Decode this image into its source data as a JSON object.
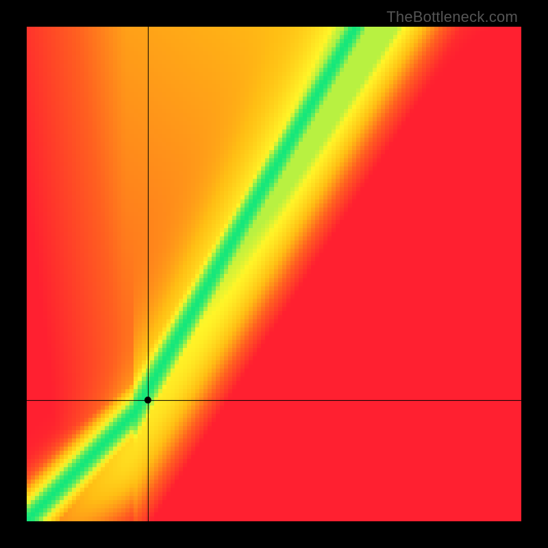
{
  "watermark": "TheBottleneck.com",
  "chart_data": {
    "type": "heatmap",
    "title": "",
    "xlabel": "",
    "ylabel": "",
    "x_range": [
      0,
      1
    ],
    "y_range": [
      0,
      1
    ],
    "grid_resolution": 120,
    "crosshair": {
      "x": 0.245,
      "y": 0.245
    },
    "marker": {
      "x": 0.245,
      "y": 0.245,
      "radius_px": 5
    },
    "colormap": [
      {
        "t": 0.0,
        "color": [
          255,
          32,
          48
        ]
      },
      {
        "t": 0.25,
        "color": [
          255,
          96,
          32
        ]
      },
      {
        "t": 0.5,
        "color": [
          255,
          190,
          20
        ]
      },
      {
        "t": 0.75,
        "color": [
          255,
          245,
          40
        ]
      },
      {
        "t": 1.0,
        "color": [
          0,
          230,
          130
        ]
      }
    ],
    "field": {
      "description": "Green ridge along curve C(x); warmth increases with distance from ridge and toward lower-left/edges.",
      "ridge": {
        "piecewise": "for x<=0.22: y=x; for x>0.22: y = 0.22 + (x-0.22)*1.75",
        "half_width_normal": 0.035
      },
      "corner_bias": "radial cool-to-warm from top-right toward bottom-left"
    }
  }
}
